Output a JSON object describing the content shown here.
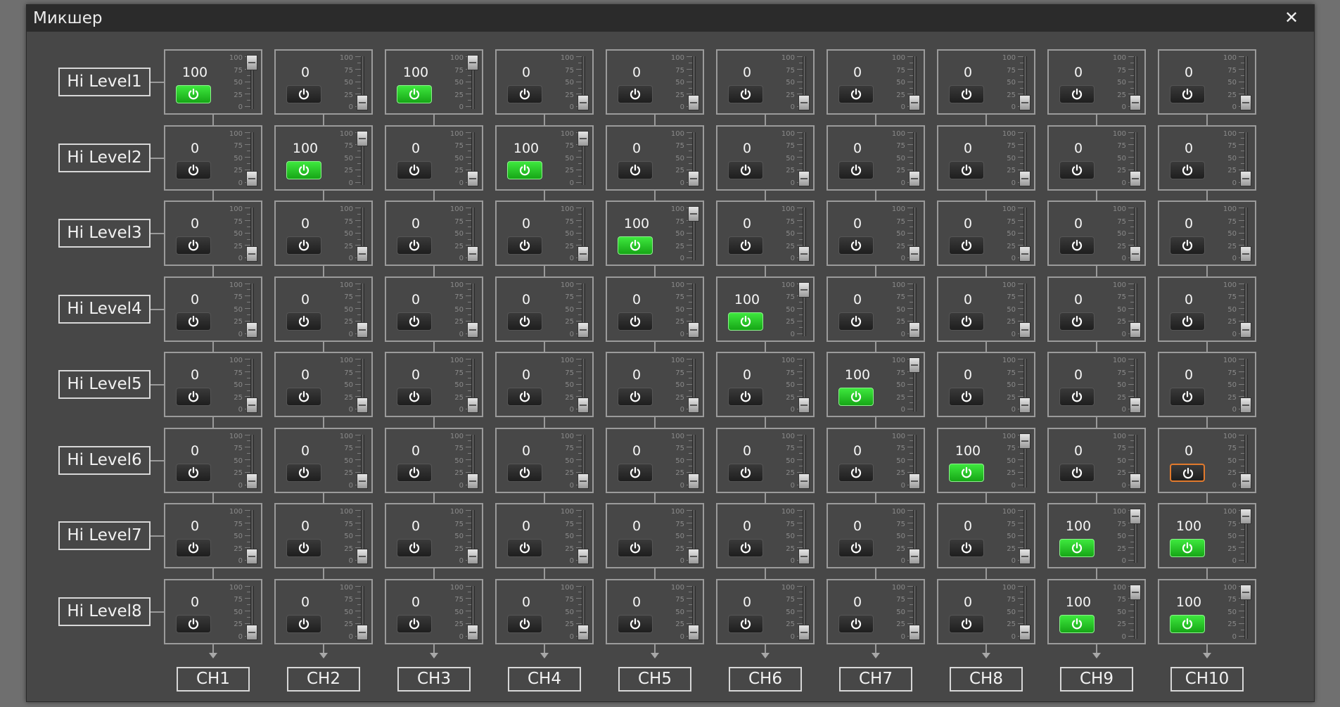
{
  "window": {
    "title": "Микшер"
  },
  "rows": [
    "Hi Level1",
    "Hi Level2",
    "Hi Level3",
    "Hi Level4",
    "Hi Level5",
    "Hi Level6",
    "Hi Level7",
    "Hi Level8"
  ],
  "channels": [
    "CH1",
    "CH2",
    "CH3",
    "CH4",
    "CH5",
    "CH6",
    "CH7",
    "CH8",
    "CH9",
    "CH10"
  ],
  "scale_labels": [
    "100",
    "75",
    "50",
    "25",
    "0"
  ],
  "colors": {
    "power_on": "#22c122",
    "focus_outline": "#e27a2d",
    "window_bg": "#474747",
    "titlebar_bg": "#2b2b2b"
  },
  "matrix": [
    [
      100,
      0,
      100,
      0,
      0,
      0,
      0,
      0,
      0,
      0
    ],
    [
      0,
      100,
      0,
      100,
      0,
      0,
      0,
      0,
      0,
      0
    ],
    [
      0,
      0,
      0,
      0,
      100,
      0,
      0,
      0,
      0,
      0
    ],
    [
      0,
      0,
      0,
      0,
      0,
      100,
      0,
      0,
      0,
      0
    ],
    [
      0,
      0,
      0,
      0,
      0,
      0,
      100,
      0,
      0,
      0
    ],
    [
      0,
      0,
      0,
      0,
      0,
      0,
      0,
      100,
      0,
      0
    ],
    [
      0,
      0,
      0,
      0,
      0,
      0,
      0,
      0,
      100,
      100
    ],
    [
      0,
      0,
      0,
      0,
      0,
      0,
      0,
      0,
      100,
      100
    ]
  ],
  "enabled": [
    [
      true,
      false,
      true,
      false,
      false,
      false,
      false,
      false,
      false,
      false
    ],
    [
      false,
      true,
      false,
      true,
      false,
      false,
      false,
      false,
      false,
      false
    ],
    [
      false,
      false,
      false,
      false,
      true,
      false,
      false,
      false,
      false,
      false
    ],
    [
      false,
      false,
      false,
      false,
      false,
      true,
      false,
      false,
      false,
      false
    ],
    [
      false,
      false,
      false,
      false,
      false,
      false,
      true,
      false,
      false,
      false
    ],
    [
      false,
      false,
      false,
      false,
      false,
      false,
      false,
      true,
      false,
      false
    ],
    [
      false,
      false,
      false,
      false,
      false,
      false,
      false,
      false,
      true,
      true
    ],
    [
      false,
      false,
      false,
      false,
      false,
      false,
      false,
      false,
      true,
      true
    ]
  ],
  "focused_cell": {
    "row": 6,
    "col": 10
  },
  "icons": {
    "power": "power-icon",
    "close": "close-icon",
    "arrow": "arrow-down-icon"
  }
}
